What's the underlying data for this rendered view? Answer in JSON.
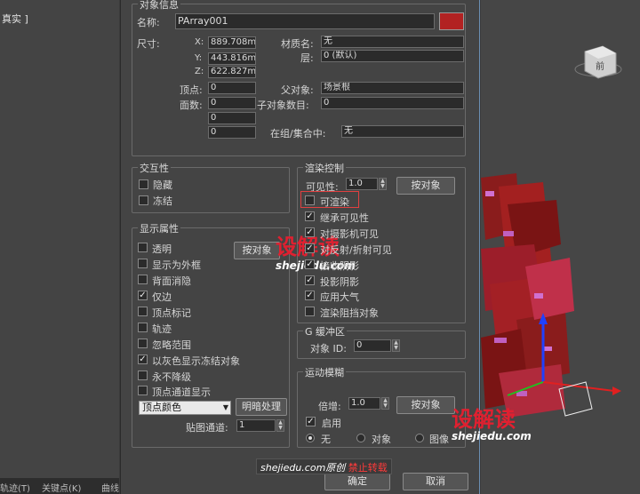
{
  "background": {
    "left_viewport_label": "真实 ]",
    "status_bar": [
      "轨迹(T)",
      "关键点(K)",
      "曲线"
    ]
  },
  "object_info": {
    "title": "对象信息",
    "name_label": "名称:",
    "name_value": "PArray001",
    "color": "#b22222",
    "dims_label": "尺寸:",
    "x_label": "X:",
    "x_value": "889.708mm",
    "y_label": "Y:",
    "y_value": "443.816mm",
    "z_label": "Z:",
    "z_value": "622.827mm",
    "vertices_label": "顶点:",
    "vertices_value": "0",
    "faces_label": "面数:",
    "faces_value": "0",
    "extra1_value": "0",
    "extra2_value": "0",
    "material_label": "材质名:",
    "material_value": "无",
    "layer_label": "层:",
    "layer_value": "0 (默认)",
    "parent_label": "父对象:",
    "parent_value": "场景根",
    "children_label": "子对象数目:",
    "children_value": "0",
    "group_label": "在组/集合中:",
    "group_value": "无"
  },
  "interactivity": {
    "title": "交互性",
    "hide_label": "隐藏",
    "freeze_label": "冻结"
  },
  "display_props": {
    "title": "显示属性",
    "by_object_label": "按对象",
    "items": [
      {
        "label": "透明",
        "checked": false
      },
      {
        "label": "显示为外框",
        "checked": false
      },
      {
        "label": "背面消隐",
        "checked": false
      },
      {
        "label": "仅边",
        "checked": true
      },
      {
        "label": "顶点标记",
        "checked": false
      },
      {
        "label": "轨迹",
        "checked": false
      },
      {
        "label": "忽略范围",
        "checked": false
      },
      {
        "label": "以灰色显示冻结对象",
        "checked": true
      },
      {
        "label": "永不降级",
        "checked": false
      },
      {
        "label": "顶点通道显示",
        "checked": false
      }
    ],
    "vertex_color_value": "顶点颜色",
    "shading_label": "明暗处理",
    "map_channel_label": "贴图通道:",
    "map_channel_value": "1"
  },
  "render_control": {
    "title": "渲染控制",
    "visibility_label": "可见性:",
    "visibility_value": "1.0",
    "by_object_label": "按对象",
    "items": [
      {
        "label": "可渲染",
        "checked": false
      },
      {
        "label": "继承可见性",
        "checked": true
      },
      {
        "label": "对摄影机可见",
        "checked": true
      },
      {
        "label": "对反射/折射可见",
        "checked": true
      },
      {
        "label": "接收阴影",
        "checked": true
      },
      {
        "label": "投影阴影",
        "checked": true
      },
      {
        "label": "应用大气",
        "checked": true
      },
      {
        "label": "渲染阻挡对象",
        "checked": false
      }
    ],
    "highlight_color": "#e04040"
  },
  "gbuffer": {
    "title": "G 缓冲区",
    "object_id_label": "对象 ID:",
    "object_id_value": "0"
  },
  "motion_blur": {
    "title": "运动模糊",
    "multiplier_label": "倍增:",
    "multiplier_value": "1.0",
    "by_object_label": "按对象",
    "enabled_label": "启用",
    "none_label": "无",
    "object_label": "对象",
    "image_label": "图像"
  },
  "footer": {
    "ok_label": "确定",
    "cancel_label": "取消"
  },
  "watermarks": {
    "brand": "设解读",
    "url": "shejiedu.com",
    "credit_prefix": "shejiedu.com原创",
    "credit_suffix": "禁止转载"
  },
  "viewcube_label": "前"
}
